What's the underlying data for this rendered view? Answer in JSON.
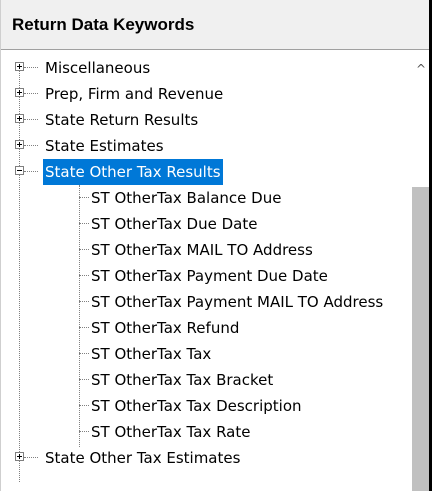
{
  "header": {
    "title": "Return Data Keywords"
  },
  "tree": {
    "items": [
      {
        "label": "Miscellaneous"
      },
      {
        "label": "Prep, Firm and Revenue"
      },
      {
        "label": "State Return Results"
      },
      {
        "label": "State Estimates"
      },
      {
        "label": "State Other Tax Results",
        "children": [
          "ST OtherTax Balance Due",
          "ST OtherTax Due Date",
          "ST OtherTax MAIL TO Address",
          "ST OtherTax Payment Due Date",
          "ST OtherTax Payment MAIL TO Address",
          "ST OtherTax Refund",
          "ST OtherTax Tax",
          "ST OtherTax Tax Bracket",
          "ST OtherTax Tax Description",
          "ST OtherTax Tax Rate"
        ]
      },
      {
        "label": "State Other Tax Estimates"
      }
    ]
  },
  "scrollbar": {
    "up_glyph": "^"
  }
}
